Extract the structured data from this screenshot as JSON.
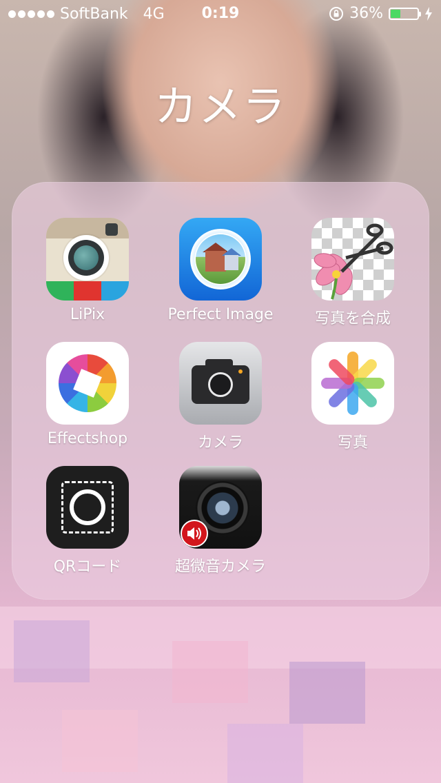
{
  "status_bar": {
    "carrier": "SoftBank",
    "network": "4G",
    "time": "0:19",
    "battery_text": "36%",
    "battery_level": 0.36
  },
  "folder": {
    "title": "カメラ",
    "apps": [
      {
        "label": "LiPix",
        "icon": "lipix-icon"
      },
      {
        "label": "Perfect Image",
        "icon": "perfect-image-icon"
      },
      {
        "label": "写真を合成",
        "icon": "photo-composite-icon"
      },
      {
        "label": "Effectshop",
        "icon": "effectshop-icon"
      },
      {
        "label": "カメラ",
        "icon": "camera-icon"
      },
      {
        "label": "写真",
        "icon": "photos-icon"
      },
      {
        "label": "QRコード",
        "icon": "qr-code-icon"
      },
      {
        "label": "超微音カメラ",
        "icon": "silent-camera-icon"
      }
    ]
  },
  "colors": {
    "battery_fill": "#4cd964",
    "folder_bg": "rgba(235,205,225,.62)"
  }
}
